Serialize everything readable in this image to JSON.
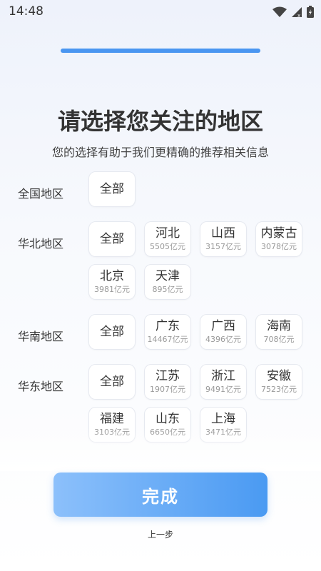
{
  "status_bar": {
    "time": "14:48"
  },
  "progress": {
    "value": 1.0
  },
  "header": {
    "title": "请选择您关注的地区",
    "subtitle": "您的选择有助于我们更精确的推荐相关信息"
  },
  "regions": [
    {
      "label": "全国地区",
      "items": [
        {
          "name": "全部",
          "amount": ""
        }
      ]
    },
    {
      "label": "华北地区",
      "items": [
        {
          "name": "全部",
          "amount": ""
        },
        {
          "name": "河北",
          "amount": "5505亿元"
        },
        {
          "name": "山西",
          "amount": "3157亿元"
        },
        {
          "name": "内蒙古",
          "amount": "3078亿元"
        },
        {
          "name": "北京",
          "amount": "3981亿元"
        },
        {
          "name": "天津",
          "amount": "895亿元"
        }
      ]
    },
    {
      "label": "华南地区",
      "items": [
        {
          "name": "全部",
          "amount": ""
        },
        {
          "name": "广东",
          "amount": "14467亿元"
        },
        {
          "name": "广西",
          "amount": "4396亿元"
        },
        {
          "name": "海南",
          "amount": "708亿元"
        }
      ]
    },
    {
      "label": "华东地区",
      "items": [
        {
          "name": "全部",
          "amount": ""
        },
        {
          "name": "江苏",
          "amount": "1907亿元"
        },
        {
          "name": "浙江",
          "amount": "9491亿元"
        },
        {
          "name": "安徽",
          "amount": "7523亿元"
        },
        {
          "name": "福建",
          "amount": "3103亿元"
        },
        {
          "name": "山东",
          "amount": "6650亿元"
        },
        {
          "name": "上海",
          "amount": "3471亿元"
        }
      ]
    }
  ],
  "actions": {
    "finish_label": "完成",
    "back_label": "上一步"
  },
  "colors": {
    "accent": "#4a96f1"
  }
}
